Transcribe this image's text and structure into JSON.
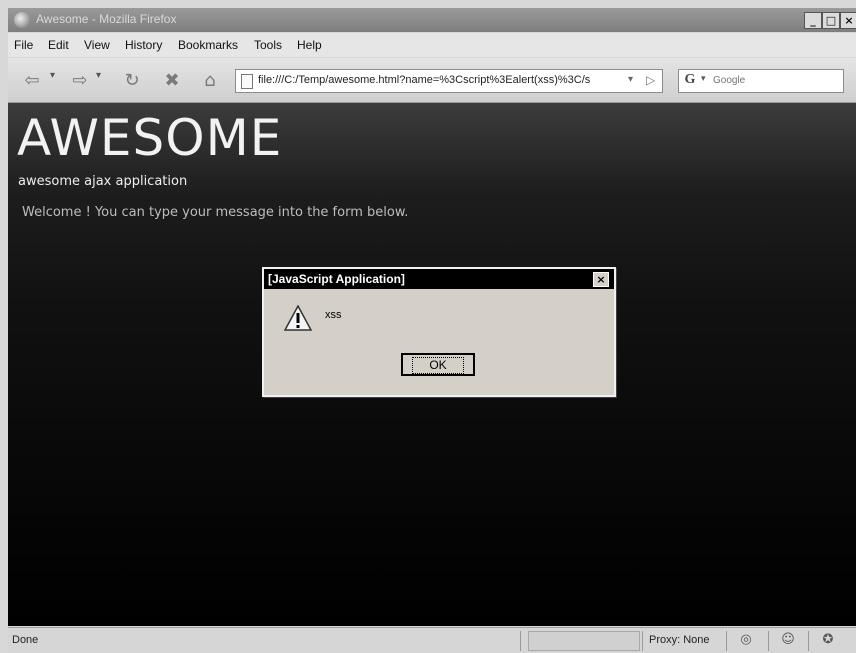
{
  "window": {
    "title": "Awesome - Mozilla Firefox",
    "controls": {
      "minimize": "_",
      "maximize": "□",
      "close": "×"
    }
  },
  "menu": {
    "items": [
      "File",
      "Edit",
      "View",
      "History",
      "Bookmarks",
      "Tools",
      "Help"
    ]
  },
  "toolbar": {
    "back_icon": "⇦",
    "forward_icon": "⇨",
    "reload_icon": "↻",
    "stop_icon": "✖",
    "home_icon": "⌂",
    "dropdown_icon": "▾",
    "url": "file:///C:/Temp/awesome.html?name=%3Cscript%3Ealert(xss)%3C/s",
    "go_icon": "▷",
    "search_engine": "G",
    "search_placeholder": "Google"
  },
  "page": {
    "title": "AWESOME",
    "subtitle": "awesome ajax application",
    "welcome": "Welcome ! You can type your message into the form below."
  },
  "dialog": {
    "title": "[JavaScript Application]",
    "close": "×",
    "message": "xss",
    "ok_label": "OK"
  },
  "statusbar": {
    "text": "Done",
    "proxy": "Proxy: None"
  },
  "colors": {
    "page_bg_top": "#3c3c3c",
    "page_bg_bottom": "#000000",
    "dialog_bg": "#d4d0c8"
  }
}
